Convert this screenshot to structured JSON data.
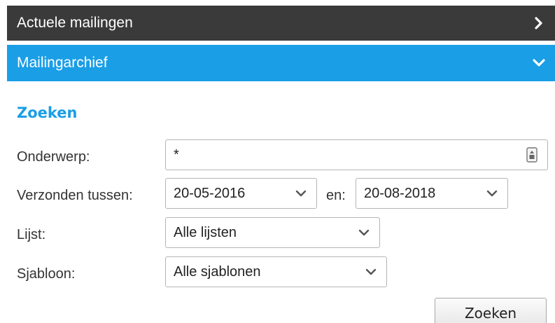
{
  "accordion": {
    "current_label": "Actuele mailingen",
    "archive_label": "Mailingarchief"
  },
  "colors": {
    "dark_bar": "#3b3a3a",
    "accent_blue": "#1a9ee6"
  },
  "search": {
    "title": "Zoeken",
    "subject_label": "Onderwerp:",
    "subject_value": "*",
    "sent_between_label": "Verzonden tussen:",
    "date_from": "20-05-2016",
    "date_and_label": "en:",
    "date_to": "20-08-2018",
    "list_label": "Lijst:",
    "list_value": "Alle lijsten",
    "template_label": "Sjabloon:",
    "template_value": "Alle sjablonen",
    "submit_label": "Zoeken"
  },
  "icons": {
    "current_chevron": "chevron-right-icon",
    "archive_chevron": "chevron-down-icon",
    "subject_field": "text-field-icon",
    "dropdown_caret": "caret-down-icon"
  }
}
